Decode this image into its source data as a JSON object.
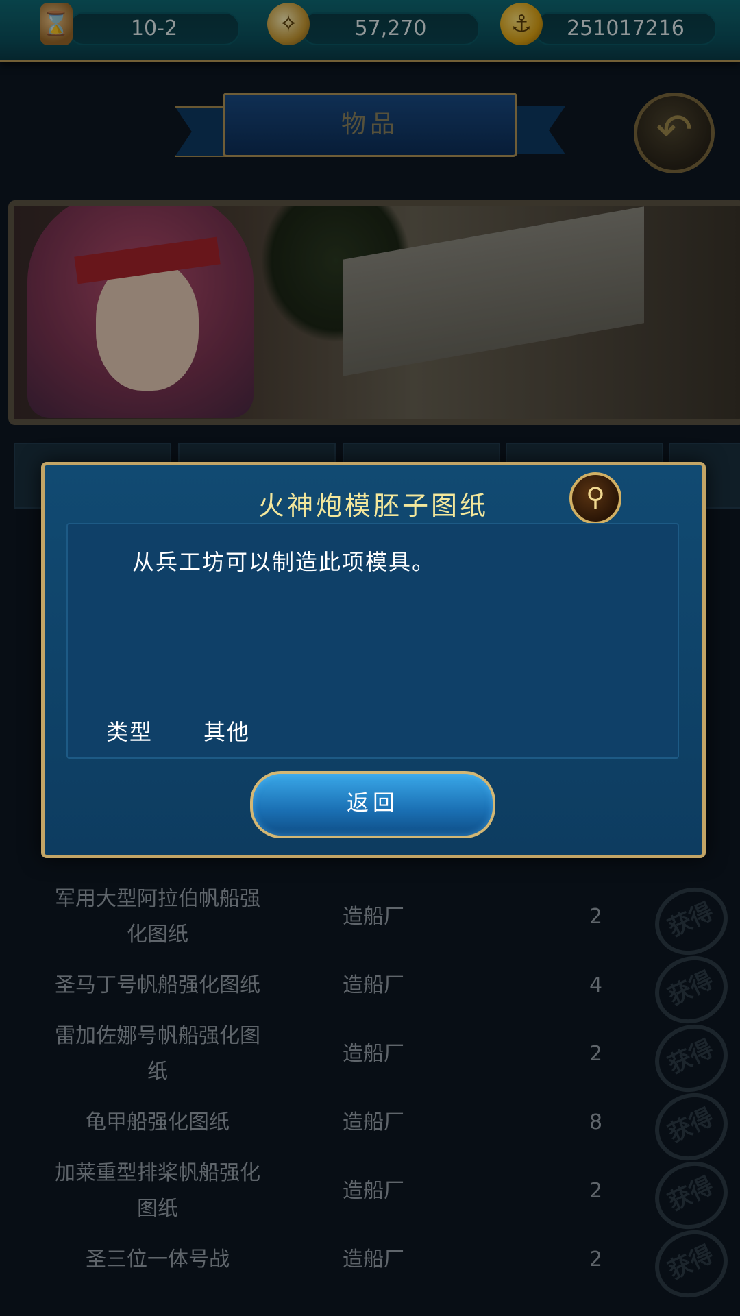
{
  "resources": {
    "stage": "10-2",
    "compass_value": "57,270",
    "gold_value": "251017216"
  },
  "header": {
    "title": "物品"
  },
  "list": {
    "rows": [
      {
        "name": "军用大型阿拉伯帆船强化图纸",
        "source": "造船厂",
        "count": "2",
        "obtain": "获得"
      },
      {
        "name": "圣马丁号帆船强化图纸",
        "source": "造船厂",
        "count": "4",
        "obtain": "获得"
      },
      {
        "name": "雷加佐娜号帆船强化图纸",
        "source": "造船厂",
        "count": "2",
        "obtain": "获得"
      },
      {
        "name": "龟甲船强化图纸",
        "source": "造船厂",
        "count": "8",
        "obtain": "获得"
      },
      {
        "name": "加莱重型排桨帆船强化图纸",
        "source": "造船厂",
        "count": "2",
        "obtain": "获得"
      },
      {
        "name": "圣三位一体号战",
        "source": "造船厂",
        "count": "2",
        "obtain": "获得"
      }
    ]
  },
  "popup": {
    "title": "火神炮模胚子图纸",
    "description": "从兵工坊可以制造此项模具。",
    "type_label": "类型",
    "type_value": "其他",
    "return_label": "返回"
  }
}
